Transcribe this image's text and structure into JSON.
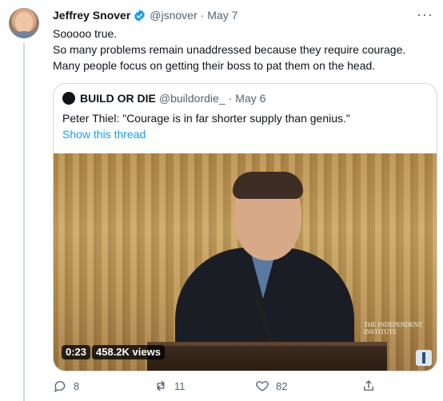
{
  "tweet": {
    "author_name": "Jeffrey Snover",
    "handle": "@jsnover",
    "separator": "·",
    "date": "May 7",
    "more_glyph": "···",
    "text_lines": [
      "Sooooo true.",
      "So many problems remain unaddressed because they require courage.",
      "Many people focus on getting their boss to pat them on the head."
    ]
  },
  "quote": {
    "author_name": "BUILD OR DIE",
    "handle": "@buildordie_",
    "separator": "·",
    "date": "May 6",
    "text": "Peter Thiel: \"Courage is in far shorter supply than genius.\"",
    "show_thread": "Show this thread",
    "video": {
      "duration": "0:23",
      "views": "458.2K views",
      "watermark": "The INDEPENDENT INSTITUTE"
    }
  },
  "actions": {
    "replies": "8",
    "retweets": "11",
    "likes": "82"
  },
  "colors": {
    "link": "#1d9bf0",
    "muted": "#536471",
    "border": "#cfd9de"
  }
}
